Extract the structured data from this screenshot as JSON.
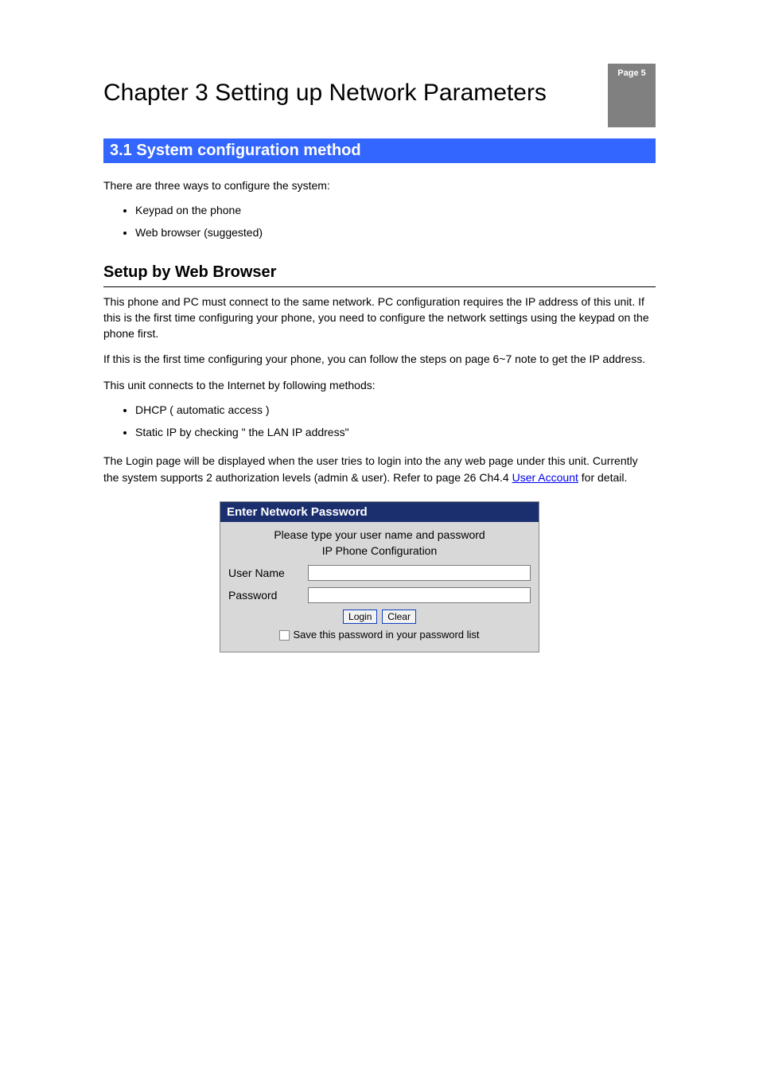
{
  "tab": {
    "label": "Page 5"
  },
  "chapter": {
    "number": "3",
    "title": "Chapter 3 Setting up Network Parameters"
  },
  "section": {
    "title": "3.1 System configuration method",
    "intro": "There are three ways to configure the system:",
    "methods": [
      "Keypad on the phone",
      "Web browser (suggested)"
    ]
  },
  "login_section": {
    "heading": "Setup by Web Browser",
    "p1": "This phone and PC must connect to the same network. PC configuration requires the IP address of this unit. If this is the first time configuring your phone, you need to configure the network settings using the keypad on the phone first.",
    "p2_prefix": "If this is the first time configuring your phone, you can follow the steps on ",
    "p2_ref": "page 6~7 note",
    "p2_suffix": " to get the IP address.",
    "p3": "This unit connects to the Internet by following methods:",
    "connect_methods": [
      "DHCP ( automatic access )",
      "Static IP by checking \" the LAN IP address\""
    ],
    "p4_prefix": "The Login page will be displayed when the user tries to login into the any web page under this unit. Currently the system supports 2 authorization levels (admin & user). Refer to page 26 Ch4.4 ",
    "p4_ref": "User Account",
    "p4_suffix": " for detail."
  },
  "login_box": {
    "header": "Enter Network Password",
    "prompt": "Please type your user name and password",
    "subtitle": "IP Phone Configuration",
    "username_label": "User Name",
    "password_label": "Password",
    "login_btn": "Login",
    "clear_btn": "Clear",
    "save_label": "Save this password in your password list"
  }
}
